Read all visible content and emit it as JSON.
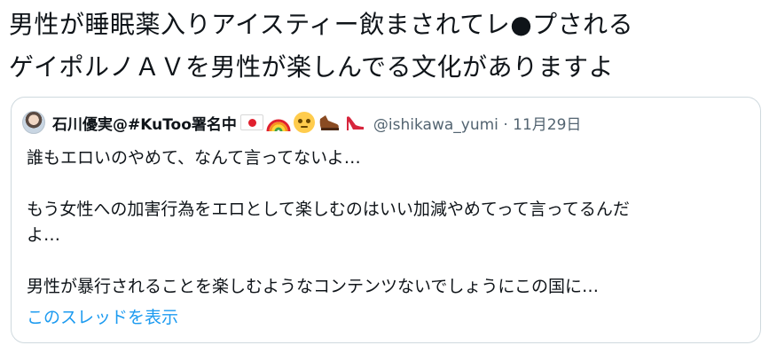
{
  "tweet": {
    "text_lines": [
      "男性が睡眠薬入りアイスティー飲まされてレ●プされる",
      "ゲイポルノＡＶを男性が楽しんでる文化がありますよ"
    ]
  },
  "quoted_tweet": {
    "display_name": "石川優実@#KuToo署名中",
    "emojis": [
      "japan-flag-icon",
      "rainbow-icon",
      "rolling-eyes-face-icon",
      "brown-shoe-icon",
      "high-heel-icon"
    ],
    "handle": "@ishikawa_yumi",
    "separator": "·",
    "date": "11月29日",
    "body_lines": [
      "誰もエロいのやめて、なんて言ってないよ…",
      "",
      "もう女性への加害行為をエロとして楽しむのはいい加減やめてって言ってるんだ",
      "よ…",
      "",
      "男性が暴行されることを楽しむようなコンテンツないでしょうにこの国に…"
    ],
    "show_thread_label": "このスレッドを表示"
  },
  "colors": {
    "text": "#0f1419",
    "secondary_text": "#536471",
    "link": "#1d9bf0",
    "border": "#cfd9de"
  }
}
